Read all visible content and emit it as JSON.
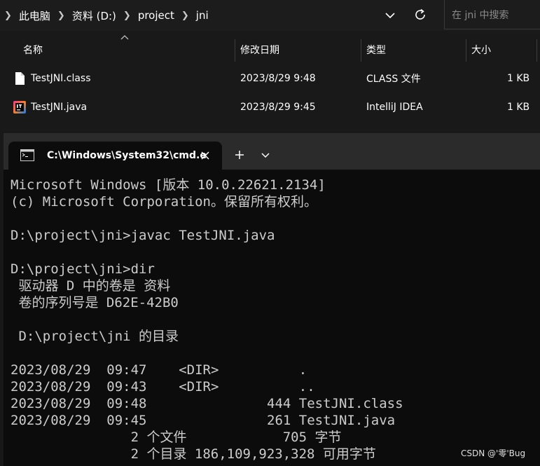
{
  "explorer": {
    "breadcrumb": [
      "此电脑",
      "资料 (D:)",
      "project",
      "jni"
    ],
    "search_placeholder": "在 jni 中搜索",
    "columns": {
      "name": "名称",
      "modified": "修改日期",
      "type": "类型",
      "size": "大小"
    },
    "files": [
      {
        "name": "TestJNI.class",
        "modified": "2023/8/29 9:48",
        "type": "CLASS 文件",
        "size": "1 KB",
        "icon": "file-icon"
      },
      {
        "name": "TestJNI.java",
        "modified": "2023/8/29 9:45",
        "type": "IntelliJ IDEA",
        "size": "1 KB",
        "icon": "intellij-icon"
      }
    ]
  },
  "terminal": {
    "tab_title": "C:\\Windows\\System32\\cmd.e",
    "lines": [
      "Microsoft Windows [版本 10.0.22621.2134]",
      "(c) Microsoft Corporation。保留所有权利。",
      "",
      "D:\\project\\jni>javac TestJNI.java",
      "",
      "D:\\project\\jni>dir",
      " 驱动器 D 中的卷是 资料",
      " 卷的序列号是 D62E-42B0",
      "",
      " D:\\project\\jni 的目录",
      "",
      "2023/08/29  09:47    <DIR>          .",
      "2023/08/29  09:43    <DIR>          ..",
      "2023/08/29  09:48               444 TestJNI.class",
      "2023/08/29  09:45               261 TestJNI.java",
      "               2 个文件            705 字节",
      "               2 个目录 186,109,923,328 可用字节"
    ]
  },
  "watermark": "CSDN @'零'Bug"
}
